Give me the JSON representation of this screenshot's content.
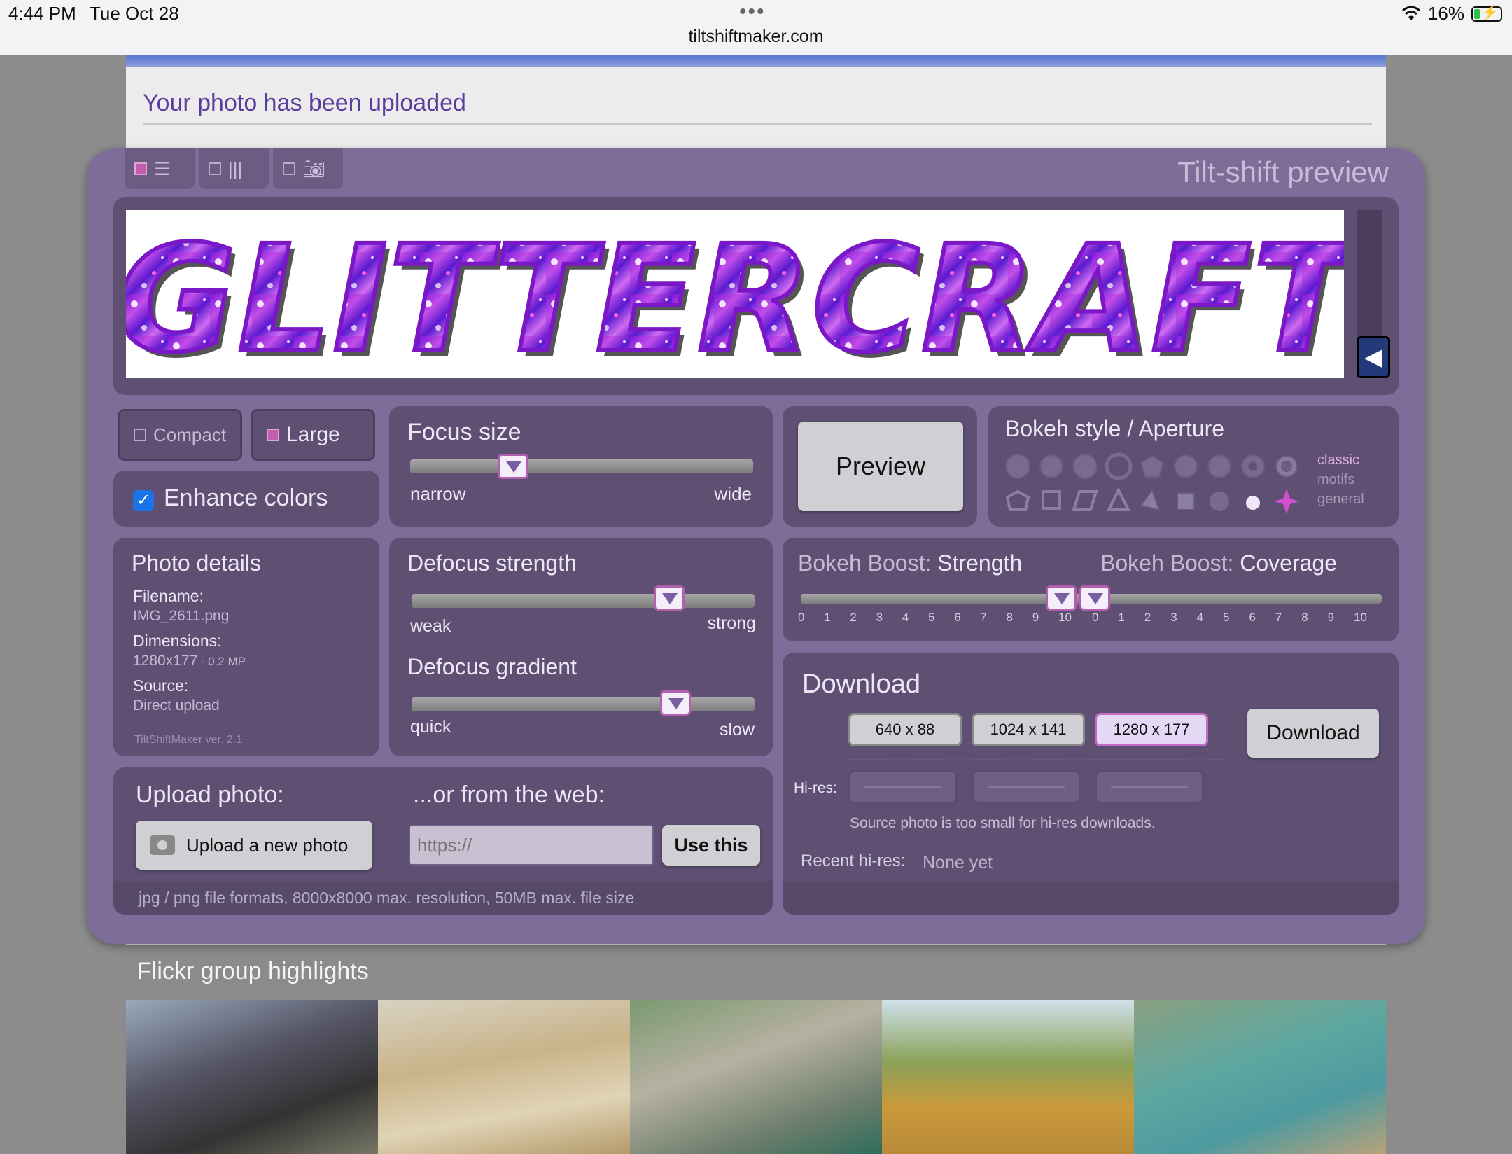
{
  "status_bar": {
    "time": "4:44 PM",
    "date": "Tue Oct 28",
    "dots": "•••",
    "url": "tiltshiftmaker.com",
    "battery": "16%"
  },
  "page": {
    "upload_message": "Your photo has been uploaded"
  },
  "panel": {
    "title": "Tilt-shift preview",
    "view_tabs": [
      {
        "name": "list",
        "checked": true
      },
      {
        "name": "columns",
        "checked": false
      },
      {
        "name": "camera",
        "checked": false
      }
    ],
    "photo_alt": "GLITTERCRAFT",
    "size_options": {
      "compact": "Compact",
      "large": "Large"
    },
    "enhance_colors": "Enhance colors",
    "focus": {
      "title": "Focus size",
      "left": "narrow",
      "right": "wide",
      "value": 0.3
    },
    "preview_button": "Preview",
    "bokeh_style": {
      "title": "Bokeh style / Aperture",
      "categories": [
        "classic",
        "motifs",
        "general"
      ]
    },
    "photo_details": {
      "title": "Photo details",
      "filename_label": "Filename:",
      "filename": "IMG_2611.png",
      "dimensions_label": "Dimensions:",
      "dimensions": "1280x177",
      "megapixels": "- 0.2 MP",
      "source_label": "Source:",
      "source": "Direct upload",
      "version": "TiltShiftMaker ver. 2.1"
    },
    "defocus_strength": {
      "title": "Defocus strength",
      "left": "weak",
      "right": "strong",
      "value": 0.75
    },
    "defocus_gradient": {
      "title": "Defocus gradient",
      "left": "quick",
      "right": "slow",
      "value": 0.77
    },
    "bokeh_boost": {
      "strength_prefix": "Bokeh Boost:",
      "strength_label": "Strength",
      "coverage_prefix": "Bokeh Boost:",
      "coverage_label": "Coverage",
      "ticks": [
        "0",
        "1",
        "2",
        "3",
        "4",
        "5",
        "6",
        "7",
        "8",
        "9",
        "10"
      ],
      "strength_value": 10,
      "coverage_value": 0
    },
    "upload": {
      "title": "Upload photo:",
      "button": "Upload a new photo",
      "web_title": "...or from the web:",
      "url_placeholder": "https://",
      "use_button": "Use this",
      "note": "jpg / png file formats, 8000x8000 max. resolution, 50MB max. file size"
    },
    "download": {
      "title": "Download",
      "sizes": [
        "640 x 88",
        "1024 x 141",
        "1280 x 177"
      ],
      "selected_index": 2,
      "button": "Download",
      "hires_label": "Hi-res:",
      "hires_note": "Source photo is too small for hi-res downloads.",
      "recent_label": "Recent hi-res:",
      "recent_value": "None yet"
    }
  },
  "flickr": {
    "title": "Flickr group highlights"
  },
  "colors": {
    "panel": "#7e6d98",
    "box": "#5e4f73",
    "accent": "#c45cb0",
    "link": "#5a3e9e"
  }
}
